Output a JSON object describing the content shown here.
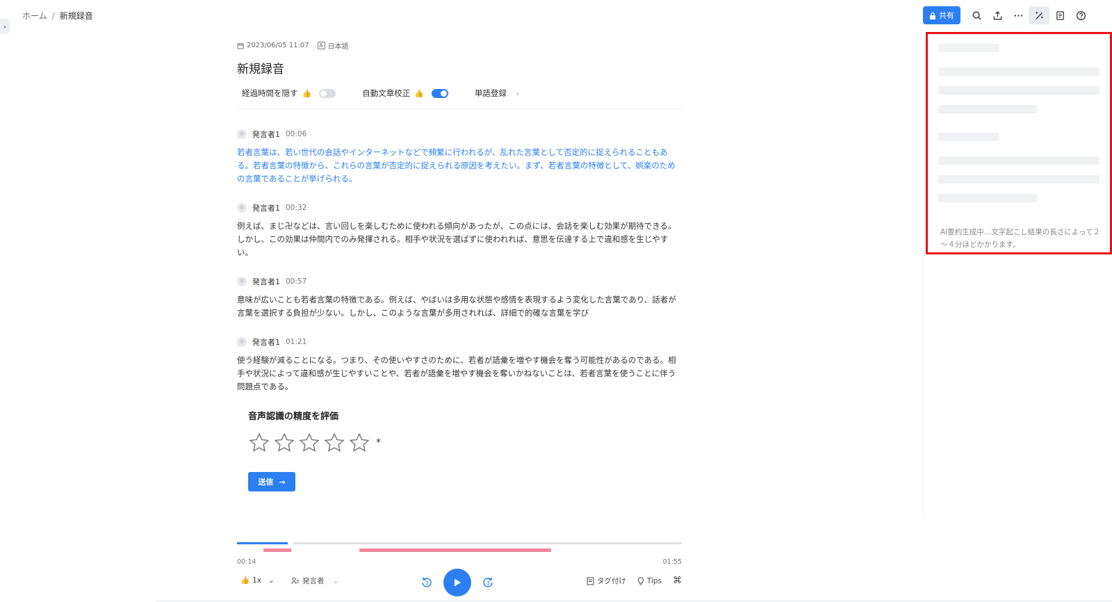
{
  "breadcrumb": {
    "home": "ホーム",
    "separator": "/",
    "current": "新規録音"
  },
  "toolbar": {
    "share_label": "共有"
  },
  "meta": {
    "datetime": "2023/06/05 11:07",
    "language": "日本語",
    "lang_icon": "A"
  },
  "title": "新規録音",
  "controls": {
    "hide_elapsed": {
      "label": "経過時間を隠す",
      "on": false
    },
    "auto_correct": {
      "label": "自動文章校正",
      "on": true
    },
    "word_register": {
      "label": "単語登録"
    }
  },
  "segments": [
    {
      "speaker": "発言者1",
      "time": "00:06",
      "current": true,
      "text": "若者言葉は、若い世代の会話やインターネットなどで頻繁に行われるが、乱れた言葉として否定的に捉えられることもある。若者言葉の特徴から、これらの言葉が否定的に捉えられる原因を考えたい。まず、若者言葉の特徴として、娯楽のための言葉であることが挙げられる。"
    },
    {
      "speaker": "発言者1",
      "time": "00:32",
      "current": false,
      "text": "例えば、まじ卍などは、言い回しを楽しむために使われる傾向があったが、この点には、会話を楽しむ効果が期待できる。しかし、この効果は仲間内でのみ発揮される。相手や状況を選ばずに使われれば、意思を伝達する上で違和感を生じやすい。"
    },
    {
      "speaker": "発言者1",
      "time": "00:57",
      "current": false,
      "text": "意味が広いことも若者言葉の特徴である。例えば、やばいは多用な状態や感情を表現するよう変化した言葉であり、話者が言葉を選択する負担が少ない。しかし、このような言葉が多用されれば、詳細で的確な言葉を学び"
    },
    {
      "speaker": "発言者1",
      "time": "01:21",
      "current": false,
      "text": "使う経験が減ることになる。つまり、その使いやすさのために、若者が語彙を増やす機会を奪う可能性があるのである。相手や状況によって違和感が生じやすいことや、若者が語彙を増やす機会を奪いかねないことは、若者言葉を使うことに伴う問題点である。"
    }
  ],
  "rating": {
    "title": "音声認識の精度を評価",
    "stars_total": 5,
    "stars_selected": 0,
    "required_mark": "*",
    "submit_label": "送信",
    "submit_arrow": "→"
  },
  "ai_panel": {
    "note": "AI要約生成中…文字起こし結果の長さによって２～４分ほどかかります。"
  },
  "player": {
    "elapsed": "00:14",
    "total": "01:55",
    "progress_fraction": 0.12,
    "speed_label": "1x",
    "speaker_label": "発言者",
    "tag_label": "タグ付け",
    "tips_label": "Tips",
    "skip_back_seconds": "3",
    "skip_forward_seconds": "3"
  },
  "colors": {
    "accent": "#2b7ff0",
    "highlight_border": "#e8101a",
    "speaker_bar": "#f2879f"
  }
}
